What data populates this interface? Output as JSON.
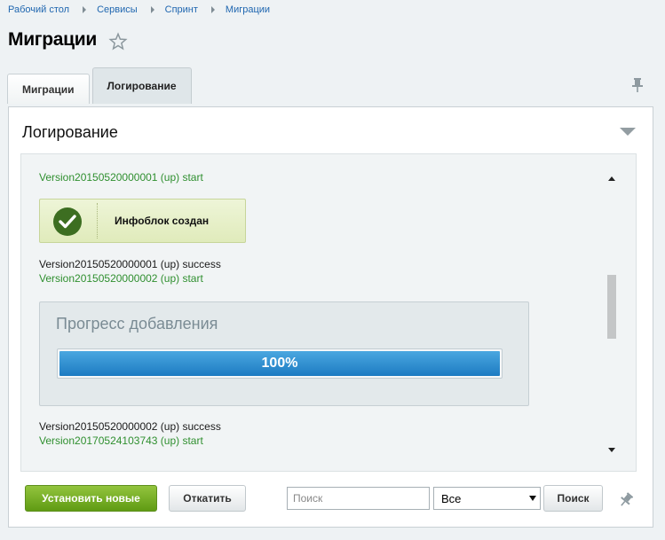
{
  "breadcrumb": [
    "Рабочий стол",
    "Сервисы",
    "Спринт",
    "Миграции"
  ],
  "page_title": "Миграции",
  "tabs": [
    {
      "label": "Миграции",
      "active": false
    },
    {
      "label": "Логирование",
      "active": true
    }
  ],
  "panel": {
    "title": "Логирование"
  },
  "log": {
    "line1": "Version20150520000001 (up) start",
    "notification": "Инфоблок создан",
    "line2": "Version20150520000001 (up) success",
    "line3": "Version20150520000002 (up) start",
    "progress_title": "Прогресс добавления",
    "progress_label": "100%",
    "progress_value": 1.0,
    "line4": "Version20150520000002 (up) success",
    "line5": "Version20170524103743 (up) start"
  },
  "actions": {
    "install_label": "Установить новые",
    "rollback_label": "Откатить",
    "search_placeholder": "Поиск",
    "filter_value": "Все",
    "search_button_label": "Поиск"
  },
  "colors": {
    "start_text": "#2f8f2f",
    "success_text": "#1a1a1a",
    "primary_button": "#6fa61c",
    "progress_fill": "#1d7bc2",
    "link": "#2067b0"
  },
  "icons": [
    "star-icon",
    "pin-icon",
    "collapse-arrow-icon",
    "check-icon",
    "scroll-up-icon",
    "scroll-down-icon",
    "select-caret-icon"
  ]
}
